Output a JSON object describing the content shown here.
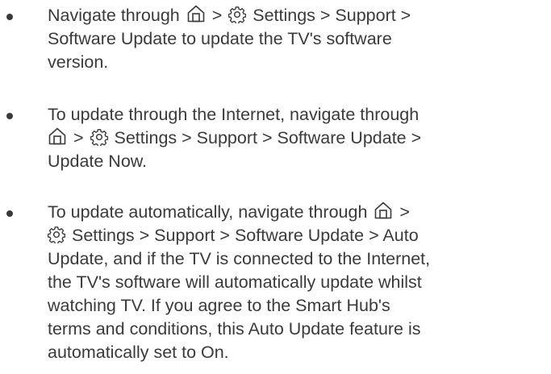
{
  "bullets": [
    {
      "lines": [
        {
          "pre": "Navigate through ",
          "mid": " > ",
          "post": " Settings > Support >"
        },
        {
          "text": "Software Update to update the TV's software"
        },
        {
          "text": "version."
        }
      ]
    },
    {
      "lines": [
        {
          "text": "To update through the Internet, navigate through"
        },
        {
          "pre": "",
          "mid": " > ",
          "post": " Settings > Support > Software Update >"
        },
        {
          "text": "Update Now."
        }
      ]
    },
    {
      "lines": [
        {
          "pre": "To update automatically, navigate through ",
          "post": " >"
        },
        {
          "post": " Settings > Support > Software Update > Auto"
        },
        {
          "text": "Update, and if the TV is connected to the Internet,"
        },
        {
          "text": "the TV's software will automatically update whilst"
        },
        {
          "text": "watching TV. If you agree to the Smart Hub's"
        },
        {
          "text": "terms and conditions, this Auto Update feature is"
        },
        {
          "text": "automatically set to On."
        }
      ]
    }
  ],
  "icons": {
    "home": "home-icon",
    "settings": "gear-icon"
  }
}
